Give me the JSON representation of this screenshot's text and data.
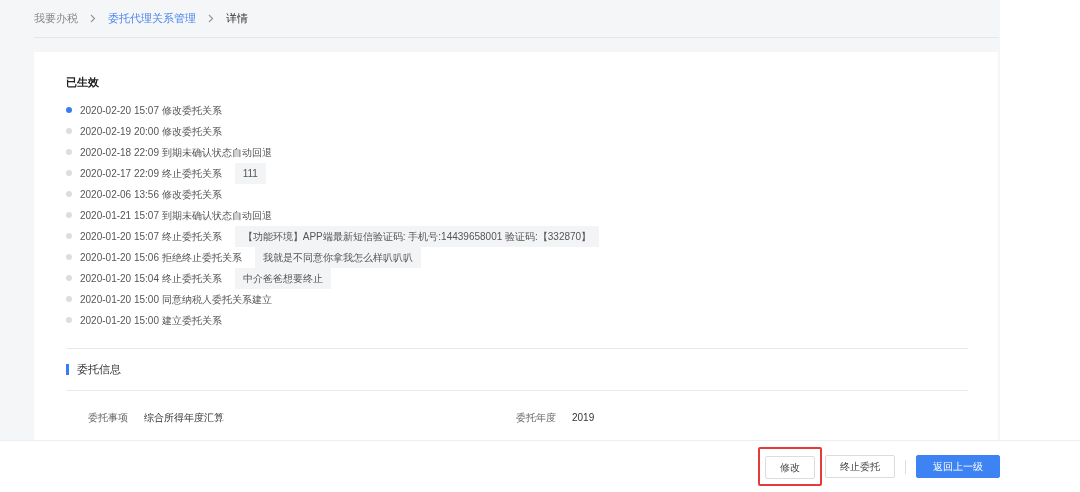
{
  "breadcrumb": [
    {
      "label": "我要办税",
      "kind": "plain"
    },
    {
      "label": "委托代理关系管理",
      "kind": "link"
    },
    {
      "label": "详情",
      "kind": "current"
    }
  ],
  "status_title": "已生效",
  "timeline": [
    {
      "time": "2020-02-20 15:07",
      "event": "修改委托关系",
      "selected": true
    },
    {
      "time": "2020-02-19 20:00",
      "event": "修改委托关系",
      "selected": false
    },
    {
      "time": "2020-02-18 22:09",
      "event": "到期未确认状态自动回退",
      "selected": false
    },
    {
      "time": "2020-02-17 22:09",
      "event": "终止委托关系",
      "note": "111",
      "selected": false
    },
    {
      "time": "2020-02-06 13:56",
      "event": "修改委托关系",
      "selected": false
    },
    {
      "time": "2020-01-21 15:07",
      "event": "到期未确认状态自动回退",
      "selected": false
    },
    {
      "time": "2020-01-20 15:07",
      "event": "终止委托关系",
      "note": "【功能环境】APP端最新短信验证码: 手机号:14439658001 验证码:【332870】",
      "selected": false
    },
    {
      "time": "2020-01-20 15:06",
      "event": "拒绝终止委托关系",
      "note": "我就是不同意你拿我怎么样叭叭叭",
      "selected": false
    },
    {
      "time": "2020-01-20 15:04",
      "event": "终止委托关系",
      "note": "中介爸爸想要终止",
      "selected": false
    },
    {
      "time": "2020-01-20 15:00",
      "event": "同意纳税人委托关系建立",
      "selected": false
    },
    {
      "time": "2020-01-20 15:00",
      "event": "建立委托关系",
      "selected": false
    }
  ],
  "section_title": "委托信息",
  "fields": [
    {
      "label": "委托事项",
      "value": "综合所得年度汇算"
    },
    {
      "label": "委托年度",
      "value": "2019"
    }
  ],
  "buttons": [
    {
      "label": "修改",
      "kind": "default",
      "highlighted": true
    },
    {
      "label": "终止委托",
      "kind": "default",
      "highlighted": false
    },
    {
      "label": "返回上一级",
      "kind": "primary",
      "highlighted": false
    }
  ]
}
